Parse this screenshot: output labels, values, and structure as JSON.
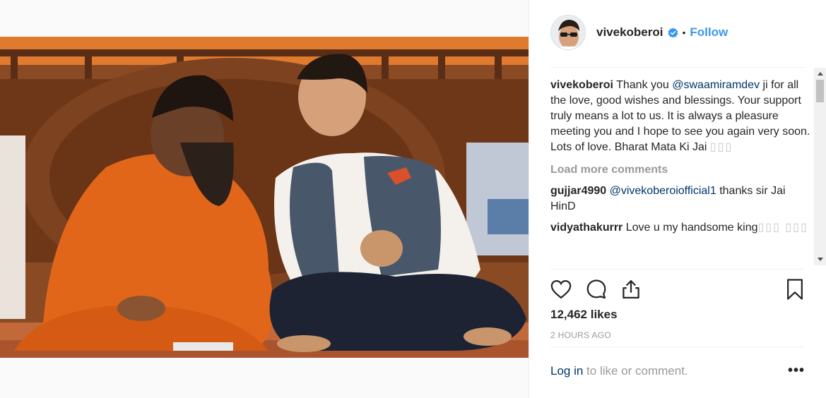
{
  "post": {
    "username": "vivekoberoi",
    "follow_label": "Follow",
    "separator": "•"
  },
  "caption": {
    "user": "vivekoberoi",
    "text_before": " Thank you ",
    "mention": "@swaamiramdev",
    "text_after": " ji for all the love, good wishes and blessings. Your support truly means a lot to us. It is always a pleasure meeting you and I hope to see you again very soon. Lots of love. Bharat Mata Ki Jai",
    "trailing_glyphs": "▯▯▯"
  },
  "load_more": "Load more comments",
  "comments": [
    {
      "user": "gujjar4990",
      "mention": "@vivekoberoiofficial1",
      "text": " thanks sir Jai HinD",
      "glyphs": ""
    },
    {
      "user": "vidyathakurrr",
      "mention": "",
      "text": " Love u my handsome king",
      "glyphs": "▯▯▯ ▯▯▯"
    }
  ],
  "icons": {
    "like": "heart-icon",
    "comment": "comment-icon",
    "share": "share-icon",
    "save": "bookmark-icon",
    "verified": "verified-badge-icon"
  },
  "likes_label": "12,462 likes",
  "timestamp": "2 HOURS AGO",
  "login": {
    "link": "Log in",
    "text": " to like or comment.",
    "more": "•••"
  },
  "colors": {
    "link_blue": "#3897f0",
    "mention": "#003569",
    "muted": "#999999"
  }
}
